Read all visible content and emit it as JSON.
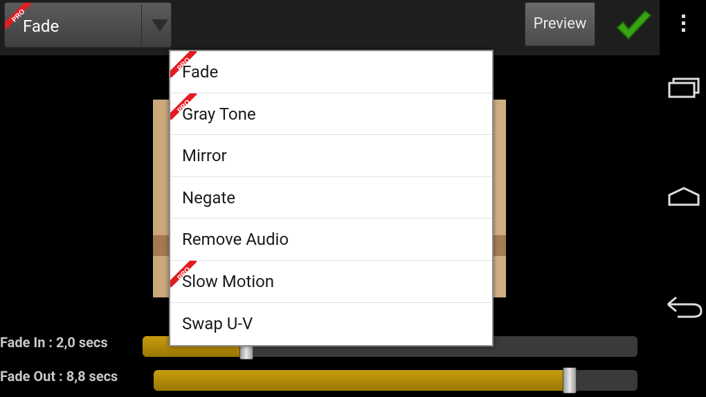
{
  "toolbar": {
    "selected_effect": "Fade",
    "preview_label": "Preview",
    "pro_badge": "PRO"
  },
  "dropdown": {
    "items": [
      {
        "label": "Fade",
        "pro": true
      },
      {
        "label": "Gray Tone",
        "pro": true
      },
      {
        "label": "Mirror",
        "pro": false
      },
      {
        "label": "Negate",
        "pro": false
      },
      {
        "label": "Remove Audio",
        "pro": false
      },
      {
        "label": "Slow Motion",
        "pro": true
      },
      {
        "label": "Swap U-V",
        "pro": false
      }
    ]
  },
  "controls": {
    "fade_in": {
      "label": "Fade In : 2,0 secs",
      "fraction": 0.21
    },
    "fade_out": {
      "label": "Fade Out : 8,8 secs",
      "fraction": 0.86
    }
  },
  "colors": {
    "accent": "#c79d10",
    "confirm": "#3aa312",
    "pro_badge": "#e31c23"
  },
  "icons": [
    "dropdown-arrow-icon",
    "checkmark-icon",
    "overflow-menu-icon",
    "recents-icon",
    "home-icon",
    "back-icon",
    "pro-badge-icon"
  ]
}
